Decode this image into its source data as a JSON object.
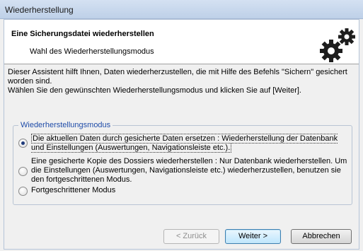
{
  "window": {
    "title": "Wiederherstellung"
  },
  "header": {
    "title": "Eine Sicherungsdatei wiederherstellen",
    "subtitle": "Wahl des Wiederherstellungsmodus",
    "icon": "gears-icon"
  },
  "intro": {
    "line1": "Dieser Assistent hilft Ihnen, Daten wiederherzustellen, die mit Hilfe des Befehls \"Sichern\" gesichert worden sind.",
    "line2": "Wählen Sie den gewünschten Wiederherstellungsmodus und klicken Sie auf [Weiter]."
  },
  "mode_group": {
    "legend": "Wiederherstellungsmodus",
    "options": [
      {
        "label": "Die aktuellen Daten durch gesicherte Daten ersetzen : Wiederherstellung der Datenbank und Einstellungen (Auswertungen, Navigationsleiste etc.).",
        "checked": true
      },
      {
        "label": "Eine gesicherte Kopie des Dossiers wiederherstellen : Nur Datenbank wiederherstellen. Um die Einstellungen (Auswertungen, Navigationsleiste etc.) wiederherzustellen, benutzen sie den fortgeschrittenen Modus.",
        "checked": false
      },
      {
        "label": "Fortgeschrittener Modus",
        "checked": false
      }
    ]
  },
  "buttons": {
    "back": "< Zurück",
    "next": "Weiter >",
    "cancel": "Abbrechen"
  }
}
